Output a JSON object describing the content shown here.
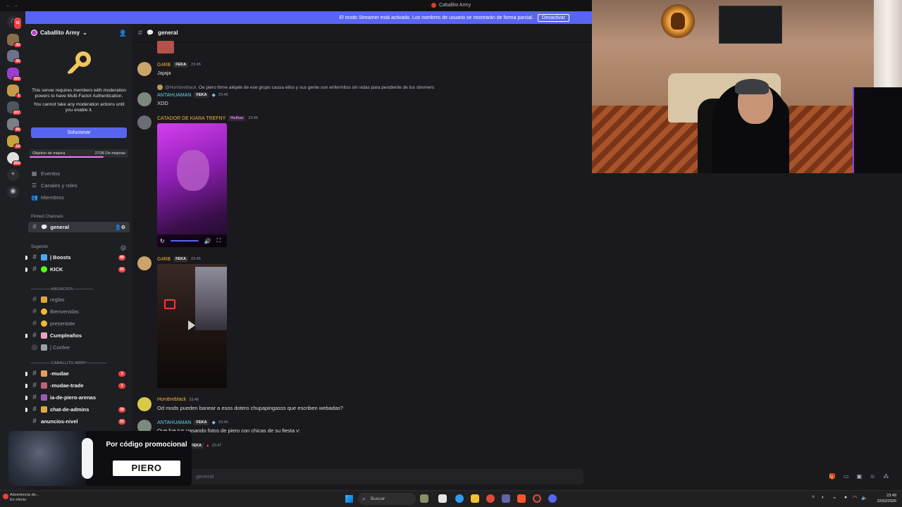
{
  "window": {
    "title": "Caballito Army"
  },
  "banner": {
    "text": "El modo Streamer está activado. Los nombres de usuario se mostrarán de forma parcial.",
    "button": "Desactivar"
  },
  "rail": {
    "servers": [
      {
        "badge": "91",
        "color": "#3a3c42"
      },
      {
        "badge": "33",
        "color": "#8b6d4a"
      },
      {
        "badge": "55",
        "color": "#6a7388"
      },
      {
        "badge": "322",
        "color": "#9b3fd1"
      },
      {
        "badge": "1",
        "color": "#c49a4a"
      },
      {
        "badge": "337",
        "color": "#4f5660"
      },
      {
        "badge": "66",
        "color": "#7b7f86"
      },
      {
        "badge": "10",
        "color": "#c9a33b"
      },
      {
        "badge": "264",
        "color": "#e0e0e0"
      }
    ]
  },
  "sidebar": {
    "server_name": "Caballito Army",
    "mfa": {
      "line1": "This server requires members with moderation powers to have Multi-Factor Authentication.",
      "line2": "You cannot take any moderation actions until you enable it.",
      "button": "Solucionar"
    },
    "boost": {
      "label": "Objetivo de mejora",
      "progress": "27/36 De mejoras",
      "fraction": 0.75
    },
    "nav": [
      {
        "label": "Eventos"
      },
      {
        "label": "Canales y roles"
      },
      {
        "label": "Miembros"
      }
    ],
    "pinned_title": "Pinned Channels",
    "pinned": {
      "name": "general"
    },
    "suggested_title": "Sugerido",
    "suggested": [
      {
        "name": "| Boosts",
        "count": "89"
      },
      {
        "name": "KICK",
        "count": "93"
      }
    ],
    "cat1": "───────ANUNCIOS───────",
    "cat1_channels": [
      {
        "name": "reglas"
      },
      {
        "name": "Bienvenidas"
      },
      {
        "name": "presentate"
      },
      {
        "name": "Cumpleaños"
      },
      {
        "name": "| Confee"
      }
    ],
    "cat2": "───────CABALLITO ARMY───────",
    "cat2_channels": [
      {
        "name": "-mudae",
        "count": "3"
      },
      {
        "name": "-mudae-trade",
        "count": "3"
      },
      {
        "name": "ia-de-piero-arenas",
        "count": ""
      },
      {
        "name": "chat-de-admins",
        "count": "30"
      },
      {
        "name": "anuncios-nivel",
        "count": "10"
      }
    ]
  },
  "chat": {
    "channel": "general",
    "messages": [
      {
        "user": "G4RB",
        "tag": "FEKA",
        "time": "23:45",
        "text": "Jajaja"
      },
      {
        "reply_user": "@Hombreblack",
        "reply_text": "Oe piero firme aléjate de ese grupo causa  ellos y sus gente son enfermitos sin vidas para pendiente de los stremers",
        "user": "ANTAHUAMAN",
        "tag": "FEKA",
        "time": "23:45",
        "text": "XDD"
      },
      {
        "user": "CATADOR DE KIARA TREFNY",
        "tag": "Hollow",
        "time": "23:45"
      },
      {
        "user": "G4RB",
        "tag": "FEKA",
        "time": "23:45"
      },
      {
        "user": "Hombreblack",
        "time": "23:46",
        "text": "Od mods pueden banear a esos dotero chupapingasss que escriben webadas?"
      },
      {
        "user": "ANTAHUAMAN",
        "tag": "FEKA",
        "time": "23:46",
        "text": "Que fue tus pasando fotos de piero con chicas de su fiesta v:"
      },
      {
        "tag": "FEKA",
        "time": "23:47"
      }
    ],
    "composer_placeholder": "general"
  },
  "promo": {
    "line": "Por código promocional",
    "code": "PIERO"
  },
  "taskbar": {
    "warning_title": "Advertencia de...",
    "warning_sub": "En efecto",
    "search": "Buscar",
    "time": "23:49",
    "date": "22/03/2026"
  }
}
